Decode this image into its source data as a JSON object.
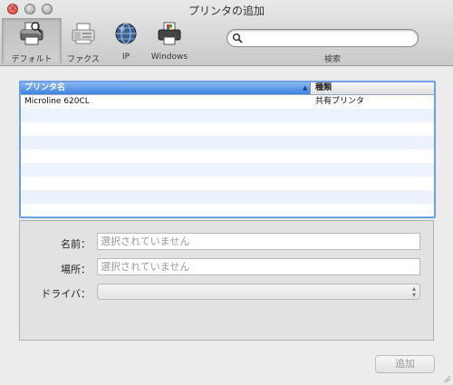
{
  "window": {
    "title": "プリンタの追加"
  },
  "toolbar": {
    "items": [
      {
        "label": "デフォルト",
        "icon": "printer-icon",
        "selected": true
      },
      {
        "label": "ファクス",
        "icon": "fax-icon",
        "selected": false
      },
      {
        "label": "IP",
        "icon": "globe-icon",
        "selected": false
      },
      {
        "label": "Windows",
        "icon": "windows-printer-icon",
        "selected": false
      }
    ],
    "search": {
      "value": "",
      "placeholder": "",
      "label": "検索"
    }
  },
  "printer_list": {
    "columns": [
      "プリンタ名",
      "種類"
    ],
    "sort_indicator": "▲",
    "rows": [
      {
        "name": "Microline 620CL",
        "type": "共有プリンタ"
      }
    ]
  },
  "details": {
    "name_label": "名前：",
    "name_value": "選択されていません",
    "location_label": "場所：",
    "location_value": "選択されていません",
    "driver_label": "ドライバ：",
    "driver_value": ""
  },
  "actions": {
    "add_label": "追加"
  },
  "colors": {
    "selection_blue": "#3c82e1",
    "list_border": "#6e9ee6",
    "close_red": "#e0342a"
  }
}
